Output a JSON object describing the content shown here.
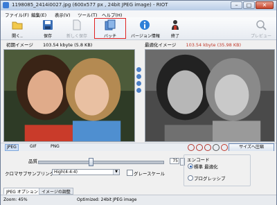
{
  "window": {
    "title": "1198085_2414i0027.jpg (600x577 px , 24bit JPEG image) - RIOT",
    "minimize": "–",
    "maximize": "□",
    "close": "✕"
  },
  "menu": [
    "ファイル(F)",
    "編集(E)",
    "表示(V)",
    "ツール(T)",
    "ヘルプ(H)"
  ],
  "toolbar": {
    "open": "開く..",
    "save": "保存",
    "save_as": "新しく保存",
    "batch": "バッチ",
    "version": "バージョン情報",
    "quit": "終了",
    "preview": "プレビュー"
  },
  "panes": {
    "original_label": "初期イメージ",
    "original_info": "103.54 kbyte (5.8 KB)",
    "optimized_label": "最適化イメージ",
    "optimized_info": "103.54 kbyte (35.98 KB)"
  },
  "formats": [
    "JPEG",
    "GIF",
    "PNG"
  ],
  "compress_button": "サイズへ圧縮",
  "options": {
    "quality_label": "品質",
    "quality_value": "75",
    "quality_unit": "%",
    "chroma_label": "クロマサブサンプリング",
    "chroma_value": "High(4:4:4)",
    "grayscale_label": "グレースケール",
    "encoding_label": "エンコード",
    "encoding_standard": "標準 最適化",
    "encoding_progressive": "プログレッシブ"
  },
  "tabs": [
    "JPEG オプション",
    "イメージの調整"
  ],
  "status": {
    "zoom": "Zoom: 45%",
    "info": "Optimized: 24bit JPEG image"
  },
  "colors": {
    "highlight": "#e02020",
    "accent": "#2a5eb0"
  }
}
